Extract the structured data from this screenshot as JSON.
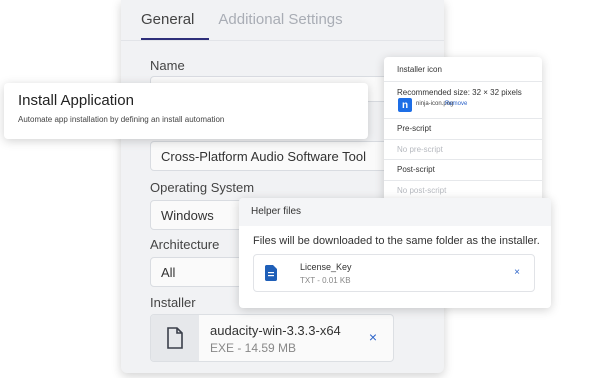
{
  "tabs": [
    "General",
    "Additional Settings"
  ],
  "form": {
    "name_label": "Name",
    "app_name": "Cross-Platform Audio Software Tool",
    "os_label": "Operating System",
    "os_value": "Windows",
    "arch_label": "Architecture",
    "arch_value": "All",
    "installer_label": "Installer",
    "installer_file": {
      "name": "audacity-win-3.3.3-x64",
      "meta": "EXE - 14.59 MB",
      "remove": "×"
    }
  },
  "install_card": {
    "title": "Install Application",
    "subtitle": "Automate app installation by defining an install automation"
  },
  "icon_panel": {
    "icon_head": "Installer icon",
    "recommended": "Recommended size: 32 × 32 pixels",
    "icon_glyph": "n",
    "icon_file": "ninja-icon.png",
    "remove": "Remove",
    "pre_head": "Pre-script",
    "pre_value": "No pre-script",
    "post_head": "Post-script",
    "post_value": "No post-script"
  },
  "helper": {
    "head": "Helper files",
    "text": "Files will be downloaded to the same folder as the installer.",
    "file": {
      "name": "License_Key",
      "meta": "TXT - 0.01 KB",
      "remove": "×"
    }
  },
  "colors": {
    "accent": "#2e2f7a",
    "link": "#2b63c9",
    "ninja": "#1d6ee6"
  }
}
